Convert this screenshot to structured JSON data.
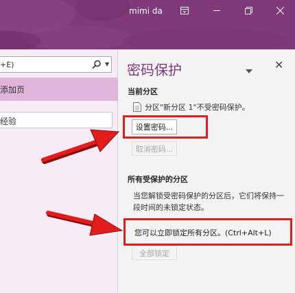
{
  "titlebar": {
    "user_name": "mimi da",
    "ribbon_icon": "ribbon-display-icon",
    "minimize_icon": "minimize-icon",
    "restore_icon": "restore-icon",
    "close_icon": "close-icon",
    "color": "#80397b"
  },
  "left_pane": {
    "search_text": "+E)",
    "search_icon": "search-icon",
    "add_page_label": "添加页",
    "page_title": "经验",
    "selected_color": "#e1b4dc"
  },
  "password_pane": {
    "title": "密码保护",
    "current_section_header": "当前分区",
    "current_status": "分区\"新分区 1\"不受密码保护。",
    "set_password_label": "设置密码...",
    "remove_password_label": "取消密码...",
    "all_protected_header": "所有受保护的分区",
    "description": "当您解锁受密码保护的分区后，它们将保持一段时间的未锁定状态。",
    "lock_now_text": "您可以立即锁定所有分区。(Ctrl+Alt+L)",
    "lock_all_label": "全部锁定",
    "title_color": "#80397b"
  },
  "annotations": {
    "highlight_color": "#e31c1c",
    "arrow_color": "#e31c1c"
  }
}
